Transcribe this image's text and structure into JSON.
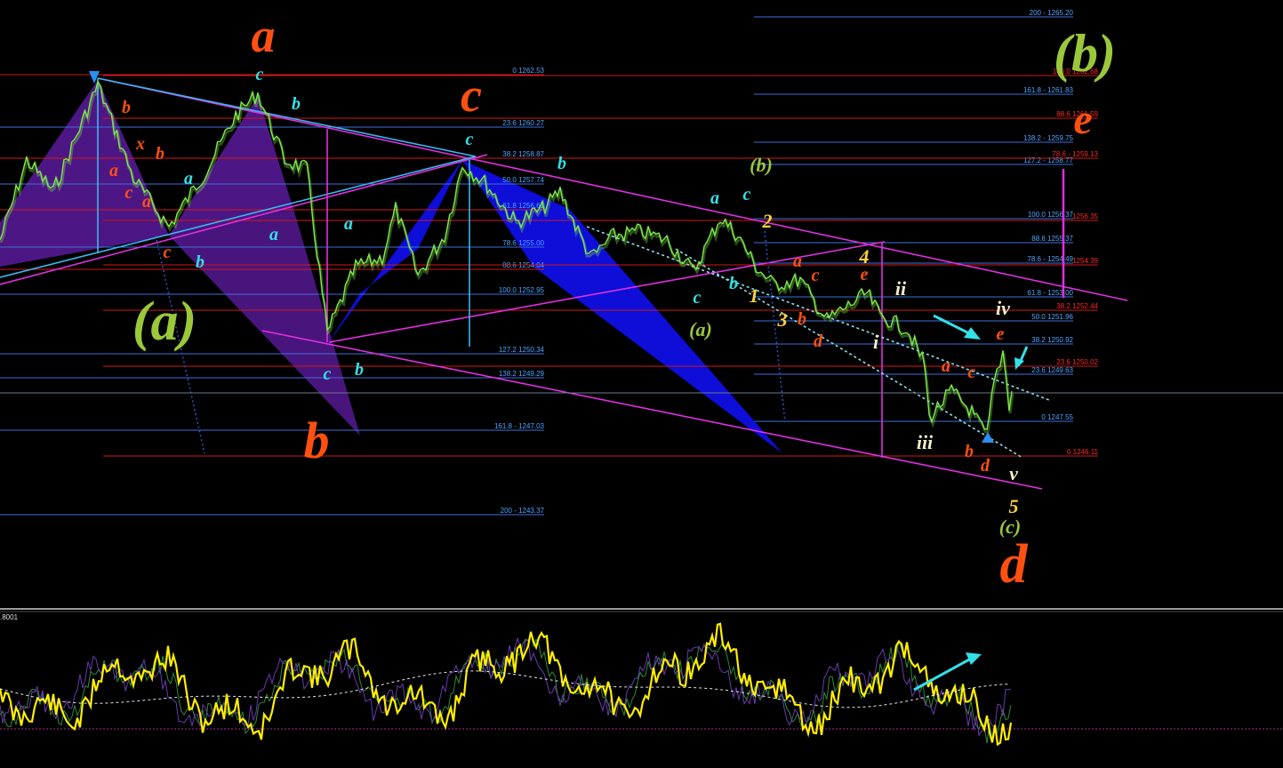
{
  "chart_data": {
    "type": "line",
    "colors": {
      "background": "#000000",
      "price_line": "#7fe84a",
      "fib_blue": "#3d6fd8",
      "fib_red": "#d01818",
      "fib_text_blue": "#4da6ff",
      "fib_text_red": "#ff2a2a",
      "trendline_magenta": "#e030e0",
      "trendline_cyan": "#3ab7f0",
      "pattern_purple": "#5a1a9c",
      "pattern_blue": "#1010f0",
      "oscillator": "#ffee00",
      "label_orange": "#ff5010",
      "label_cyan": "#33e0e8",
      "label_olive": "#9bc83a",
      "label_yellow": "#ffd23a",
      "label_white": "#f4f0c8"
    },
    "fib_left": {
      "color": "blue",
      "levels": [
        {
          "label": "0 1262.53"
        },
        {
          "label": "23.6 1260.27"
        },
        {
          "label": "38.2 1258.87"
        },
        {
          "label": "50.0 1257.74"
        },
        {
          "label": "61.8 1256.61"
        },
        {
          "label": "78.6 1255.00"
        },
        {
          "label": "88.6 1254.04"
        },
        {
          "label": "100.0 1252.95"
        },
        {
          "label": "127.2 1250.34"
        },
        {
          "label": "138.2 1249.29"
        },
        {
          "label": "161.8 - 1247.03"
        },
        {
          "label": "200 - 1243.37"
        }
      ]
    },
    "fib_right_blue": {
      "levels": [
        {
          "label": "200 - 1265.20"
        },
        {
          "label": "161.8 - 1261.83"
        },
        {
          "label": "138.2 - 1259.75"
        },
        {
          "label": "127.2 - 1258.77"
        },
        {
          "label": "100.0 1256.37"
        },
        {
          "label": "88.6 1255.37"
        },
        {
          "label": "78.6 - 1254.49"
        },
        {
          "label": "61.8 - 1253.00"
        },
        {
          "label": "50.0 1251.96"
        },
        {
          "label": "38.2 1250.92"
        },
        {
          "label": "23.6 1249.63"
        },
        {
          "label": "0 1247.55"
        }
      ]
    },
    "fib_right_red": {
      "levels": [
        {
          "label": "100.0 1262.68"
        },
        {
          "label": "88.6 1261.59"
        },
        {
          "label": "78.6 - 1259.13"
        },
        {
          "label": "1256.35"
        },
        {
          "label": "1254.39"
        },
        {
          "label": "38.2 1252.44"
        },
        {
          "label": "23.6 1250.02"
        },
        {
          "label": "0 1246.11"
        }
      ]
    },
    "wave_labels": {
      "orange_major": [
        "a",
        "b",
        "c",
        "d",
        "e"
      ],
      "olive_major": [
        "(a)",
        "(b)",
        "(c)"
      ],
      "olive_minor": [
        "(b)",
        "(a)"
      ],
      "yellow_numbers": [
        "1",
        "2",
        "3",
        "4",
        "5"
      ],
      "white_roman": [
        "i",
        "ii",
        "iii",
        "iv",
        "v"
      ],
      "small_letters": [
        "a",
        "b",
        "c",
        "d",
        "e",
        "x"
      ]
    },
    "oscillator": {
      "top_value_text": ".8001",
      "top_value_partial_visible": true
    },
    "grid": false,
    "legend": "none"
  }
}
